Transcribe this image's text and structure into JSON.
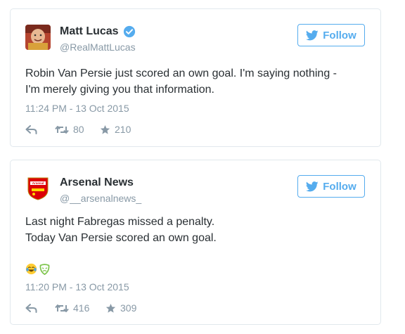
{
  "tweets": [
    {
      "author_name": "Matt Lucas",
      "verified": true,
      "handle": "@RealMattLucas",
      "follow_label": "Follow",
      "text": "Robin Van Persie just scored an own goal. I'm saying nothing -\nI'm merely giving you that information.",
      "timestamp": "11:24 PM - 13 Oct 2015",
      "retweets": "80",
      "likes": "210",
      "avatar_icon": "person-photo-icon"
    },
    {
      "author_name": "Arsenal News",
      "verified": false,
      "handle": "@__arsenalnews_",
      "follow_label": "Follow",
      "text": "Last night Fabregas missed a penalty.\nToday Van Persie scored an own goal.",
      "emojis": [
        "face-with-tears-of-joy-icon",
        "mask-face-icon"
      ],
      "timestamp": "11:20 PM - 13 Oct 2015",
      "retweets": "416",
      "likes": "309",
      "avatar_icon": "arsenal-crest-icon",
      "avatar_text": "Arsenal"
    }
  ],
  "colors": {
    "accent": "#55acee",
    "muted": "#8899a6",
    "text": "#292f33",
    "border": "#e1e8ed"
  }
}
